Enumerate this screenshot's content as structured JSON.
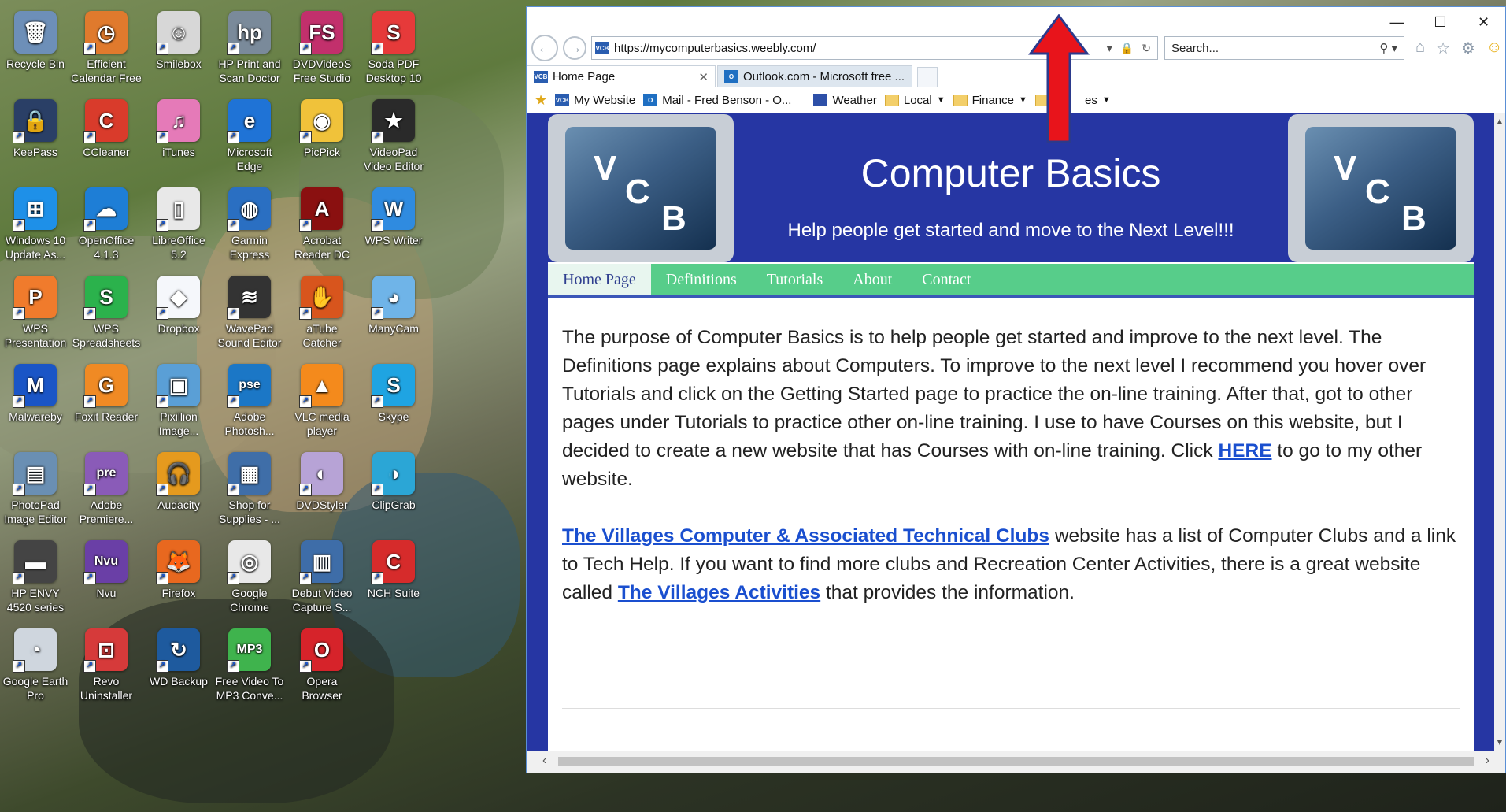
{
  "desktop": {
    "icons": [
      {
        "label": "Recycle Bin",
        "color": "#6d8fb8",
        "glyph": "🗑"
      },
      {
        "label": "Efficient Calendar Free",
        "color": "#e07a2d",
        "glyph": "◷"
      },
      {
        "label": "Smilebox",
        "color": "#d7d7d7",
        "glyph": "☺"
      },
      {
        "label": "HP Print and Scan Doctor",
        "color": "#7a8a9a",
        "glyph": "hp"
      },
      {
        "label": "DVDVideoS Free Studio",
        "color": "#c2306c",
        "glyph": "FS"
      },
      {
        "label": "Soda PDF Desktop 10",
        "color": "#e63a3a",
        "glyph": "S"
      },
      {
        "label": "KeePass",
        "color": "#2a3f66",
        "glyph": "🔒"
      },
      {
        "label": "CCleaner",
        "color": "#d93b2b",
        "glyph": "C"
      },
      {
        "label": "iTunes",
        "color": "#e57ab8",
        "glyph": "♫"
      },
      {
        "label": "Microsoft Edge",
        "color": "#1f73d6",
        "glyph": "e"
      },
      {
        "label": "PicPick",
        "color": "#f0c23a",
        "glyph": "◉"
      },
      {
        "label": "VideoPad Video Editor",
        "color": "#2a2a2a",
        "glyph": "★"
      },
      {
        "label": "Windows 10 Update As...",
        "color": "#1e90e8",
        "glyph": "⊞"
      },
      {
        "label": "OpenOffice 4.1.3",
        "color": "#1e7ed6",
        "glyph": "☁"
      },
      {
        "label": "LibreOffice 5.2",
        "color": "#e8e8e8",
        "glyph": "▯"
      },
      {
        "label": "Garmin Express",
        "color": "#2a6fc2",
        "glyph": "◍"
      },
      {
        "label": "Acrobat Reader DC",
        "color": "#8a1010",
        "glyph": "A"
      },
      {
        "label": "WPS Writer",
        "color": "#2f8be0",
        "glyph": "W"
      },
      {
        "label": "WPS Presentation",
        "color": "#f07b2c",
        "glyph": "P"
      },
      {
        "label": "WPS Spreadsheets",
        "color": "#2bb24c",
        "glyph": "S"
      },
      {
        "label": "Dropbox",
        "color": "#f5f7fb",
        "glyph": "◆"
      },
      {
        "label": "WavePad Sound Editor",
        "color": "#333",
        "glyph": "≋"
      },
      {
        "label": "aTube Catcher",
        "color": "#d8551d",
        "glyph": "✋"
      },
      {
        "label": "ManyCam",
        "color": "#6fb4e8",
        "glyph": "◕"
      },
      {
        "label": "Malwareby",
        "color": "#1a55c6",
        "glyph": "M"
      },
      {
        "label": "Foxit Reader",
        "color": "#f08a24",
        "glyph": "G"
      },
      {
        "label": "Pixillion Image...",
        "color": "#5a9fd6",
        "glyph": "▣"
      },
      {
        "label": "Adobe Photosh...",
        "color": "#1b77c6",
        "glyph": "pse"
      },
      {
        "label": "VLC media player",
        "color": "#f48a1c",
        "glyph": "▲"
      },
      {
        "label": "Skype",
        "color": "#1fa4e2",
        "glyph": "S"
      },
      {
        "label": "PhotoPad Image Editor",
        "color": "#6a8fb3",
        "glyph": "▤"
      },
      {
        "label": "Adobe Premiere...",
        "color": "#8a5bb8",
        "glyph": "pre"
      },
      {
        "label": "Audacity",
        "color": "#e59a1e",
        "glyph": "🎧"
      },
      {
        "label": "Shop for Supplies - ...",
        "color": "#3f6ea8",
        "glyph": "▦"
      },
      {
        "label": "DVDStyler",
        "color": "#b7a3d6",
        "glyph": "◐"
      },
      {
        "label": "ClipGrab",
        "color": "#2ba6d6",
        "glyph": "◑"
      },
      {
        "label": "HP ENVY 4520 series",
        "color": "#444",
        "glyph": "▬"
      },
      {
        "label": "Nvu",
        "color": "#6a3fa6",
        "glyph": "Nvu"
      },
      {
        "label": "Firefox",
        "color": "#e8681f",
        "glyph": "🦊"
      },
      {
        "label": "Google Chrome",
        "color": "#e8e8e8",
        "glyph": "◎"
      },
      {
        "label": "Debut Video Capture S...",
        "color": "#3e6da8",
        "glyph": "▥"
      },
      {
        "label": "NCH Suite",
        "color": "#d62b2b",
        "glyph": "C"
      },
      {
        "label": "Google Earth Pro",
        "color": "#cfd6de",
        "glyph": "◔"
      },
      {
        "label": "Revo Uninstaller",
        "color": "#d63a3a",
        "glyph": "⊡"
      },
      {
        "label": "WD Backup",
        "color": "#1e5a9e",
        "glyph": "↻"
      },
      {
        "label": "Free Video To MP3 Conve...",
        "color": "#3fb34d",
        "glyph": "MP3"
      },
      {
        "label": "Opera Browser",
        "color": "#d6232a",
        "glyph": "O"
      }
    ]
  },
  "browser": {
    "window_controls": {
      "minimize": "—",
      "maximize": "☐",
      "close": "✕"
    },
    "url": "https://mycomputerbasics.weebly.com/",
    "search_placeholder": "Search...",
    "favicon_text": "VCB",
    "tabs": [
      {
        "label": "Home Page"
      },
      {
        "label": "Outlook.com - Microsoft free ..."
      }
    ],
    "favorites": [
      {
        "label": "My Website",
        "type": "link"
      },
      {
        "label": "Mail - Fred Benson - O...",
        "type": "link"
      },
      {
        "label": "Weather",
        "type": "link"
      },
      {
        "label": "Local",
        "type": "folder"
      },
      {
        "label": "Finance",
        "type": "folder"
      },
      {
        "label": "W      es",
        "type": "folder"
      }
    ]
  },
  "site": {
    "title": "Computer Basics",
    "subtitle": "Help people get started and move to the Next Level!!!",
    "logo_letters": {
      "v": "V",
      "c": "C",
      "b": "B"
    },
    "menu": [
      "Home Page",
      "Definitions",
      "Tutorials",
      "About",
      "Contact"
    ],
    "para1_a": "The purpose of Computer Basics is to help people get started and improve to the next level. The Definitions page explains about Computers.  To improve to the next level I recommend you hover over Tutorials and click on the Getting Started page to practice the on-line training.  After that, got to other pages under Tutorials to practice other on-line training.  I use to have Courses on this website, but I decided to create a new website that has Courses with on-line training.  Click ",
    "para1_link": "HERE",
    "para1_b": " to go to my other website.",
    "para2_link1": "The Villages Computer & Associated Technical Clubs",
    "para2_a": " website has a list of Computer Clubs and a link to Tech Help.  If you want to find more clubs and Recreation Center Activities, there is a great website called ",
    "para2_link2": "The Villages Activities",
    "para2_b": " that provides the information."
  },
  "colors": {
    "header_blue": "#2636a3",
    "menu_green": "#57cd8a",
    "link_blue": "#1a4fcf",
    "arrow_red": "#e8141b"
  }
}
